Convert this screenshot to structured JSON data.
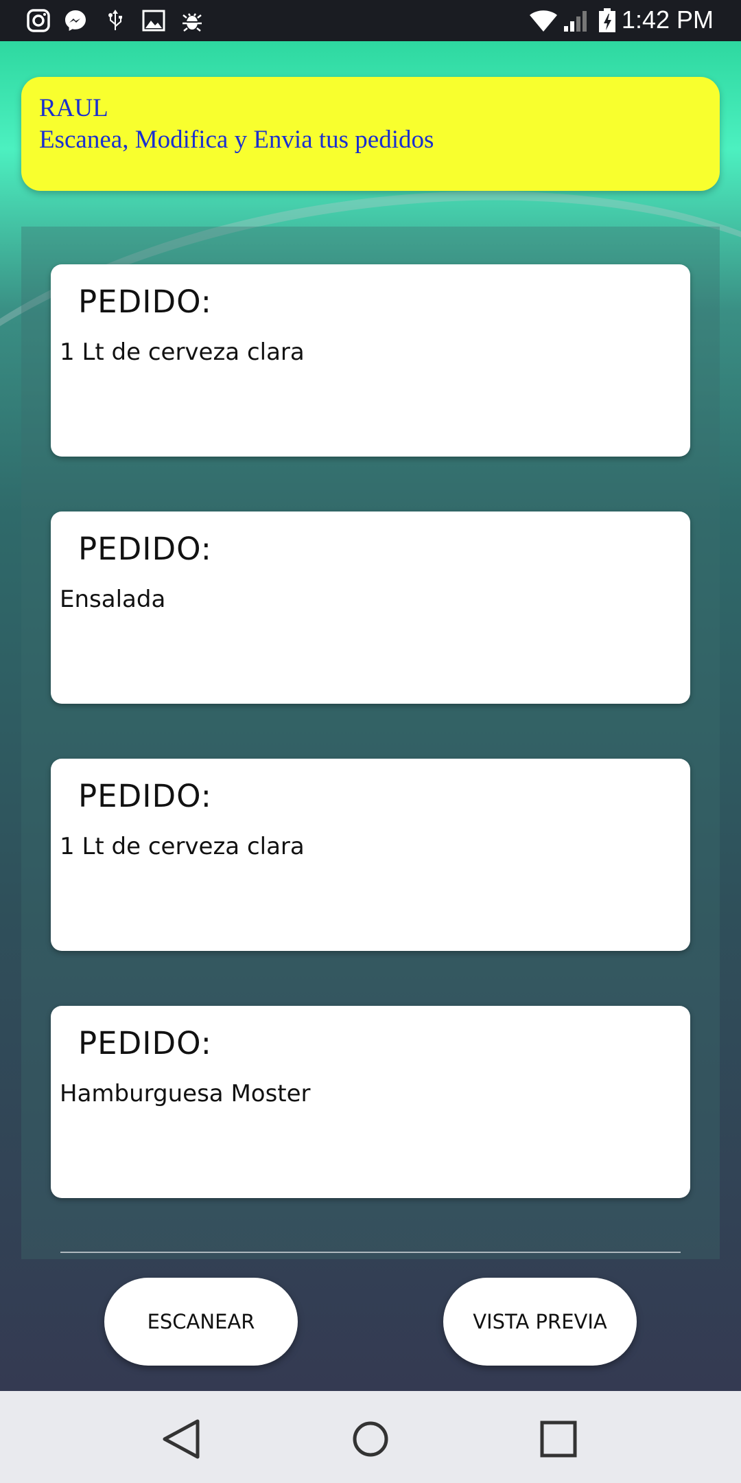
{
  "status_bar": {
    "time": "1:42 PM",
    "left_icons": [
      "instagram-icon",
      "messenger-icon",
      "usb-icon",
      "gallery-icon",
      "debug-bug-icon"
    ],
    "right_icons": [
      "wifi-icon",
      "signal-icon",
      "battery-charging-icon"
    ]
  },
  "header": {
    "name": "RAUL",
    "subtitle": "Escanea, Modifica y Envia tus pedidos",
    "background_color": "#f8ff2e",
    "text_color": "#1a2fd0"
  },
  "orders": [
    {
      "label": "PEDIDO:",
      "text": "1 Lt de cerveza clara"
    },
    {
      "label": "PEDIDO:",
      "text": "Ensalada"
    },
    {
      "label": "PEDIDO:",
      "text": "1 Lt de cerveza clara"
    },
    {
      "label": "PEDIDO:",
      "text": "Hamburguesa Moster"
    }
  ],
  "actions": {
    "scan_label": "ESCANEAR",
    "preview_label": "VISTA PREVIA"
  },
  "nav": {
    "icons": [
      "back-icon",
      "home-icon",
      "recents-icon"
    ]
  }
}
